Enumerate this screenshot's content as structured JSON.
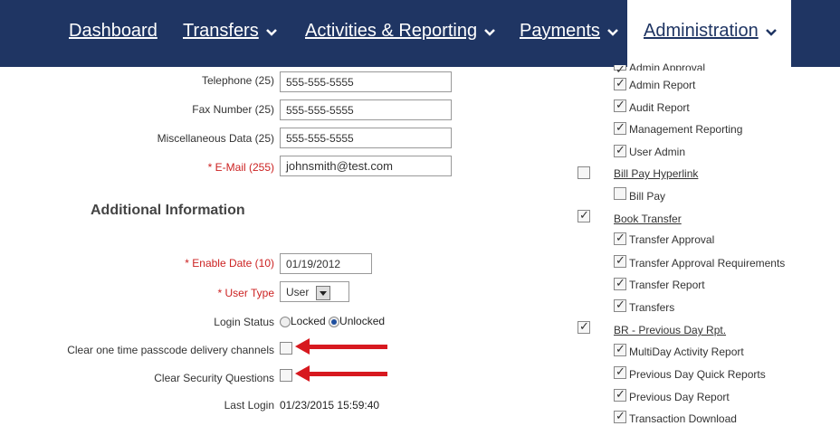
{
  "nav": {
    "items": [
      {
        "label": "Dashboard",
        "has_menu": false
      },
      {
        "label": "Transfers",
        "has_menu": true
      },
      {
        "label": "Activities & Reporting",
        "has_menu": true
      },
      {
        "label": "Payments",
        "has_menu": true
      },
      {
        "label": "Administration",
        "has_menu": true
      }
    ],
    "active": "Administration"
  },
  "form": {
    "telephone": {
      "label": "Telephone (25)",
      "value": "555-555-5555"
    },
    "fax": {
      "label": "Fax Number (25)",
      "value": "555-555-5555"
    },
    "misc": {
      "label": "Miscellaneous Data (25)",
      "value": "555-555-5555"
    },
    "email": {
      "label": "* E-Mail (255)",
      "value": "johnsmith@test.com"
    },
    "additional_title": "Additional Information",
    "enable_date": {
      "label": "* Enable Date (10)",
      "value": "01/19/2012"
    },
    "user_type": {
      "label": "* User Type",
      "value": "User"
    },
    "login_status": {
      "label": "Login Status",
      "locked": "Locked",
      "unlocked": "Unlocked",
      "selected": "Unlocked"
    },
    "clear_otp": {
      "label": "Clear one time passcode delivery channels",
      "checked": false
    },
    "clear_security": {
      "label": "Clear Security Questions",
      "checked": false
    },
    "last_login": {
      "label": "Last Login",
      "value": "01/23/2015 15:59:40"
    }
  },
  "permissions": {
    "admin_approval": "Admin Approval",
    "admin_report": "Admin Report",
    "audit_report": "Audit Report",
    "management_reporting": "Management Reporting",
    "user_admin": "User Admin",
    "bill_pay_hyperlink": "Bill Pay Hyperlink",
    "bill_pay": "Bill Pay",
    "book_transfer": "Book Transfer",
    "transfer_approval": "Transfer Approval",
    "transfer_approval_requirements": "Transfer Approval Requirements",
    "transfer_report": "Transfer Report",
    "transfers": "Transfers",
    "br_previous_day": "BR - Previous Day Rpt.",
    "multiday_activity": "MultiDay Activity Report",
    "previous_day_quick": "Previous Day Quick Reports",
    "previous_day_report": "Previous Day Report",
    "transaction_download": "Transaction Download"
  },
  "colors": {
    "nav_bg": "#1f3563",
    "required": "#cc2222",
    "arrow": "#d7191f"
  }
}
